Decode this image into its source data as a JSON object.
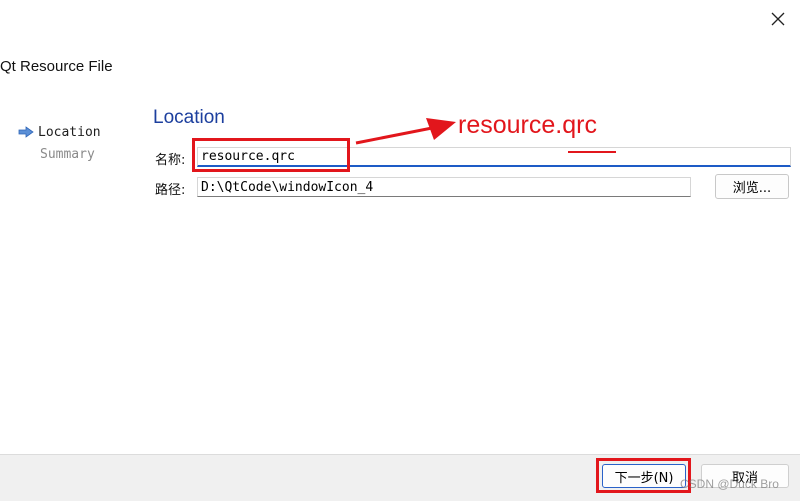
{
  "window": {
    "title": "Qt Resource File"
  },
  "steps": [
    {
      "label": "Location",
      "current": true
    },
    {
      "label": "Summary",
      "current": false
    }
  ],
  "page": {
    "heading": "Location"
  },
  "form": {
    "name_label": "名称:",
    "name_value": "resource.qrc",
    "path_label": "路径:",
    "path_value": "D:\\QtCode\\windowIcon_4",
    "browse_label": "浏览..."
  },
  "footer": {
    "next_label": "下一步(N)",
    "cancel_label": "取消"
  },
  "annotation": {
    "text": "resource.qrc",
    "color": "#e2161c"
  },
  "watermark": "CSDN @Duck Bro",
  "colors": {
    "accent": "#1d5bc6",
    "heading": "#1c3f9e",
    "annotation": "#e2161c"
  }
}
